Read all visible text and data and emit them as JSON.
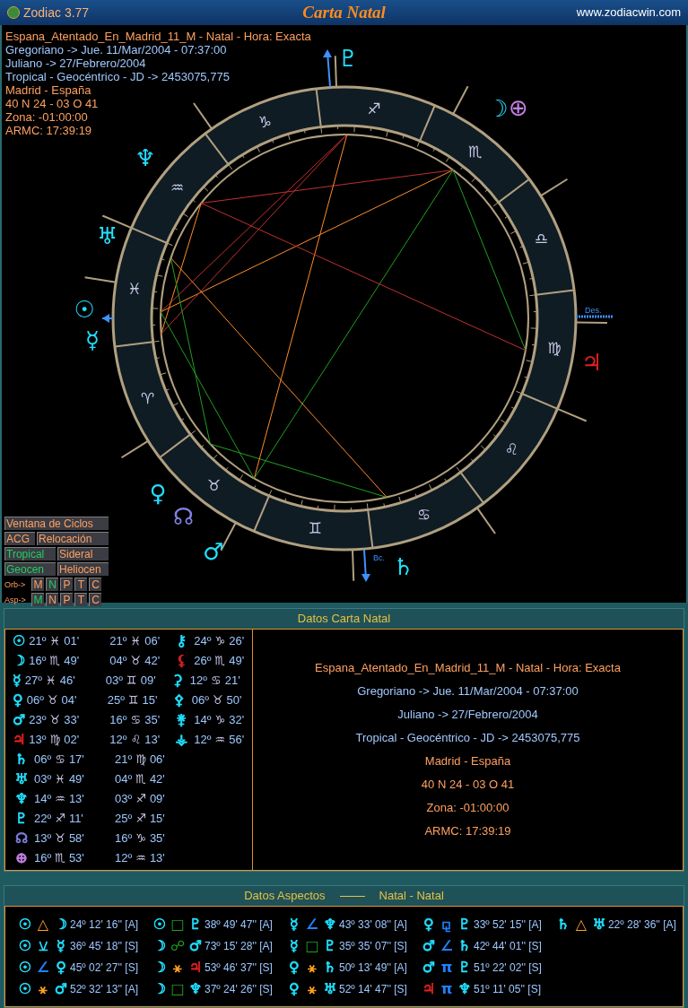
{
  "window": {
    "app": "Zodiac 3.77",
    "title": "Carta Natal",
    "website": "www.zodiacwin.com"
  },
  "chart_info": [
    {
      "text": "Espana_Atentado_En_Madrid_11_M - Natal - Hora: Exacta",
      "color": "#ffa060"
    },
    {
      "text": "Gregoriano -> Jue. 11/Mar/2004 - 07:37:00",
      "color": "#a0c8ff"
    },
    {
      "text": "Juliano -> 27/Febrero/2004",
      "color": "#a0c8ff"
    },
    {
      "text": "Tropical - Geocéntrico - JD -> 2453075,775",
      "color": "#a0c8ff"
    },
    {
      "text": "Madrid - España",
      "color": "#ffa060"
    },
    {
      "text": "40 N 24 - 03 O 41",
      "color": "#ffa060"
    },
    {
      "text": "Zona: -01:00:00",
      "color": "#ffa060"
    },
    {
      "text": "ARMC: 17:39:19",
      "color": "#ffa060"
    }
  ],
  "wheel": {
    "signs": [
      "♈",
      "♉",
      "♊",
      "♋",
      "♌",
      "♍",
      "♎",
      "♏",
      "♐",
      "♑",
      "♒",
      "♓"
    ],
    "planets": [
      {
        "glyph": "☉",
        "color": "#20e0ff"
      },
      {
        "glyph": "☽",
        "color": "#20e0ff"
      },
      {
        "glyph": "☿",
        "color": "#20e0ff"
      },
      {
        "glyph": "♀",
        "color": "#20e0ff"
      },
      {
        "glyph": "♂",
        "color": "#20e0ff"
      },
      {
        "glyph": "♃",
        "color": "#e02020"
      },
      {
        "glyph": "♄",
        "color": "#20e0ff"
      },
      {
        "glyph": "♅",
        "color": "#20e0ff"
      },
      {
        "glyph": "♆",
        "color": "#20e0ff"
      },
      {
        "glyph": "♇",
        "color": "#20e0ff"
      },
      {
        "glyph": "☊",
        "color": "#8080e0"
      },
      {
        "glyph": "⊕",
        "color": "#c080e0"
      }
    ],
    "axis_labels": [
      "Des.",
      "Bc."
    ]
  },
  "buttons": [
    [
      {
        "label": "Ventana de Ciclos",
        "selected": false
      }
    ],
    [
      {
        "label": "ACG",
        "selected": false
      },
      {
        "label": "Relocación",
        "selected": false
      }
    ],
    [
      {
        "label": "Tropical",
        "selected": true
      },
      {
        "label": "Sideral",
        "selected": false
      }
    ],
    [
      {
        "label": "Geocen",
        "selected": true
      },
      {
        "label": "Heliocen",
        "selected": false
      }
    ]
  ],
  "option_rows": [
    {
      "label": "Orb->",
      "keys": [
        {
          "label": "M",
          "selected": false
        },
        {
          "label": "N",
          "selected": true
        },
        {
          "label": "P",
          "selected": false
        },
        {
          "label": "T",
          "selected": false
        },
        {
          "label": "C",
          "selected": false
        }
      ]
    },
    {
      "label": "Asp->",
      "keys": [
        {
          "label": "M",
          "selected": true
        },
        {
          "label": "N",
          "selected": false
        },
        {
          "label": "P",
          "selected": false
        },
        {
          "label": "T",
          "selected": false
        },
        {
          "label": "C",
          "selected": false
        }
      ]
    }
  ],
  "natal_panel": {
    "title": "Datos Carta Natal",
    "rows": [
      {
        "glyph": "☉",
        "color": "#20e0ff",
        "pos": [
          "21º",
          "♓",
          "01'"
        ],
        "pos2": [
          "21º",
          "♓",
          "06'"
        ],
        "extra": {
          "glyph": "⚷",
          "color": "#20e0ff",
          "pos": [
            "24º",
            "♑",
            "26'"
          ]
        }
      },
      {
        "glyph": "☽",
        "color": "#20e0ff",
        "pos": [
          "16º",
          "♏",
          "49'"
        ],
        "pos2": [
          "04º",
          "♉",
          "42'"
        ],
        "extra": {
          "glyph": "⚸",
          "color": "#e02020",
          "pos": [
            "26º",
            "♏",
            "49'"
          ]
        }
      },
      {
        "glyph": "☿",
        "color": "#20e0ff",
        "pos": [
          "27º",
          "♓",
          "46'"
        ],
        "pos2": [
          "03º",
          "♊",
          "09'"
        ],
        "extra": {
          "glyph": "⚳",
          "color": "#20e0ff",
          "pos": [
            "12º",
            "♋",
            "21'"
          ]
        }
      },
      {
        "glyph": "♀",
        "color": "#20e0ff",
        "pos": [
          "06º",
          "♉",
          "04'"
        ],
        "pos2": [
          "25º",
          "♊",
          "15'"
        ],
        "extra": {
          "glyph": "⚴",
          "color": "#20e0ff",
          "pos": [
            "06º",
            "♉",
            "50'"
          ]
        }
      },
      {
        "glyph": "♂",
        "color": "#20e0ff",
        "pos": [
          "23º",
          "♉",
          "33'"
        ],
        "pos2": [
          "16º",
          "♋",
          "35'"
        ],
        "extra": {
          "glyph": "⚵",
          "color": "#20e0ff",
          "pos": [
            "14º",
            "♑",
            "32'"
          ]
        }
      },
      {
        "glyph": "♃",
        "color": "#e02020",
        "pos": [
          "13º",
          "♍",
          "02'"
        ],
        "pos2": [
          "12º",
          "♌",
          "13'"
        ],
        "extra": {
          "glyph": "⚶",
          "color": "#20e0ff",
          "pos": [
            "12º",
            "♒",
            "56'"
          ]
        }
      },
      {
        "glyph": "♄",
        "color": "#20e0ff",
        "pos": [
          "06º",
          "♋",
          "17'"
        ],
        "pos2": [
          "21º",
          "♍",
          "06'"
        ]
      },
      {
        "glyph": "♅",
        "color": "#20e0ff",
        "pos": [
          "03º",
          "♓",
          "49'"
        ],
        "pos2": [
          "04º",
          "♏",
          "42'"
        ]
      },
      {
        "glyph": "♆",
        "color": "#20e0ff",
        "pos": [
          "14º",
          "♒",
          "13'"
        ],
        "pos2": [
          "03º",
          "♐",
          "09'"
        ]
      },
      {
        "glyph": "♇",
        "color": "#20e0ff",
        "pos": [
          "22º",
          "♐",
          "11'"
        ],
        "pos2": [
          "25º",
          "♐",
          "15'"
        ]
      },
      {
        "glyph": "☊",
        "color": "#8080e0",
        "pos": [
          "13º",
          "♉",
          "58'"
        ],
        "pos2": [
          "16º",
          "♑",
          "35'"
        ]
      },
      {
        "glyph": "⊕",
        "color": "#c080e0",
        "pos": [
          "16º",
          "♏",
          "53'"
        ],
        "pos2": [
          "12º",
          "♒",
          "13'"
        ]
      }
    ],
    "summary": [
      {
        "text": "Espana_Atentado_En_Madrid_11_M - Natal - Hora: Exacta",
        "color": "#ffa060"
      },
      {
        "text": "Gregoriano -> Jue. 11/Mar/2004 - 07:37:00",
        "color": "#a0c8ff"
      },
      {
        "text": "Juliano -> 27/Febrero/2004",
        "color": "#a0c8ff"
      },
      {
        "text": "Tropical - Geocéntrico - JD -> 2453075,775",
        "color": "#a0c8ff"
      },
      {
        "text": "Madrid - España",
        "color": "#ffa060"
      },
      {
        "text": "40 N 24 - 03 O 41",
        "color": "#ffa060"
      },
      {
        "text": "Zona: -01:00:00",
        "color": "#ffa060"
      },
      {
        "text": "ARMC: 17:39:19",
        "color": "#ffa060"
      }
    ]
  },
  "aspects_panel": {
    "title": "Datos Aspectos",
    "subtitle": "Natal - Natal",
    "columns": [
      [
        {
          "p1": {
            "glyph": "☉",
            "color": "#20e0ff"
          },
          "aspect": {
            "glyph": "△",
            "color": "#ffa020"
          },
          "p2": {
            "glyph": "☽",
            "color": "#20e0ff"
          },
          "value": "24º 12' 16'' [A]"
        },
        {
          "p1": {
            "glyph": "☉",
            "color": "#20e0ff"
          },
          "aspect": {
            "glyph": "⚺",
            "color": "#20e0ff"
          },
          "p2": {
            "glyph": "☿",
            "color": "#20e0ff"
          },
          "value": "36º 45' 18'' [S]"
        },
        {
          "p1": {
            "glyph": "☉",
            "color": "#20e0ff"
          },
          "aspect": {
            "glyph": "∠",
            "color": "#2080ff"
          },
          "p2": {
            "glyph": "♀",
            "color": "#20e0ff"
          },
          "value": "45º 02' 27'' [S]"
        },
        {
          "p1": {
            "glyph": "☉",
            "color": "#20e0ff"
          },
          "aspect": {
            "glyph": "⚹",
            "color": "#ffa020"
          },
          "p2": {
            "glyph": "♂",
            "color": "#20e0ff"
          },
          "value": "52º 32' 13'' [A]"
        }
      ],
      [
        {
          "p1": {
            "glyph": "☉",
            "color": "#20e0ff"
          },
          "aspect": {
            "glyph": "□",
            "color": "#20a020"
          },
          "p2": {
            "glyph": "♇",
            "color": "#20e0ff"
          },
          "value": "38º 49' 47'' [A]"
        },
        {
          "p1": {
            "glyph": "☽",
            "color": "#20e0ff"
          },
          "aspect": {
            "glyph": "☍",
            "color": "#20a020"
          },
          "p2": {
            "glyph": "♂",
            "color": "#20e0ff"
          },
          "value": "73º 15' 28'' [A]"
        },
        {
          "p1": {
            "glyph": "☽",
            "color": "#20e0ff"
          },
          "aspect": {
            "glyph": "⚹",
            "color": "#ffa020"
          },
          "p2": {
            "glyph": "♃",
            "color": "#e02020"
          },
          "value": "53º 46' 37'' [S]"
        },
        {
          "p1": {
            "glyph": "☽",
            "color": "#20e0ff"
          },
          "aspect": {
            "glyph": "□",
            "color": "#20a020"
          },
          "p2": {
            "glyph": "♆",
            "color": "#20e0ff"
          },
          "value": "37º 24' 26'' [S]"
        }
      ],
      [
        {
          "p1": {
            "glyph": "☿",
            "color": "#20e0ff"
          },
          "aspect": {
            "glyph": "∠",
            "color": "#2080ff"
          },
          "p2": {
            "glyph": "♆",
            "color": "#20e0ff"
          },
          "value": "43º 33' 08'' [A]"
        },
        {
          "p1": {
            "glyph": "☿",
            "color": "#20e0ff"
          },
          "aspect": {
            "glyph": "□",
            "color": "#20a020"
          },
          "p2": {
            "glyph": "♇",
            "color": "#20e0ff"
          },
          "value": "35º 35' 07'' [S]"
        },
        {
          "p1": {
            "glyph": "♀",
            "color": "#20e0ff"
          },
          "aspect": {
            "glyph": "⚹",
            "color": "#ffa020"
          },
          "p2": {
            "glyph": "♄",
            "color": "#20e0ff"
          },
          "value": "50º 13' 49'' [A]"
        },
        {
          "p1": {
            "glyph": "♀",
            "color": "#20e0ff"
          },
          "aspect": {
            "glyph": "⚹",
            "color": "#ffa020"
          },
          "p2": {
            "glyph": "♅",
            "color": "#20e0ff"
          },
          "value": "52º 14' 47'' [S]"
        }
      ],
      [
        {
          "p1": {
            "glyph": "♀",
            "color": "#20e0ff"
          },
          "aspect": {
            "glyph": "⚼",
            "color": "#2080ff"
          },
          "p2": {
            "glyph": "♇",
            "color": "#20e0ff"
          },
          "value": "33º 52' 15'' [A]"
        },
        {
          "p1": {
            "glyph": "♂",
            "color": "#20e0ff"
          },
          "aspect": {
            "glyph": "∠",
            "color": "#2080ff"
          },
          "p2": {
            "glyph": "♄",
            "color": "#20e0ff"
          },
          "value": "42º 44' 01'' [S]"
        },
        {
          "p1": {
            "glyph": "♂",
            "color": "#20e0ff"
          },
          "aspect": {
            "glyph": "π",
            "color": "#2080ff"
          },
          "p2": {
            "glyph": "♇",
            "color": "#20e0ff"
          },
          "value": "51º 22' 02'' [S]"
        },
        {
          "p1": {
            "glyph": "♃",
            "color": "#e02020"
          },
          "aspect": {
            "glyph": "π",
            "color": "#2080ff"
          },
          "p2": {
            "glyph": "♆",
            "color": "#20e0ff"
          },
          "value": "51º 11' 05'' [S]"
        }
      ],
      [
        {
          "p1": {
            "glyph": "♄",
            "color": "#20e0ff"
          },
          "aspect": {
            "glyph": "△",
            "color": "#ffa020"
          },
          "p2": {
            "glyph": "♅",
            "color": "#20e0ff"
          },
          "value": "22º 28' 36'' [A]"
        }
      ]
    ]
  }
}
